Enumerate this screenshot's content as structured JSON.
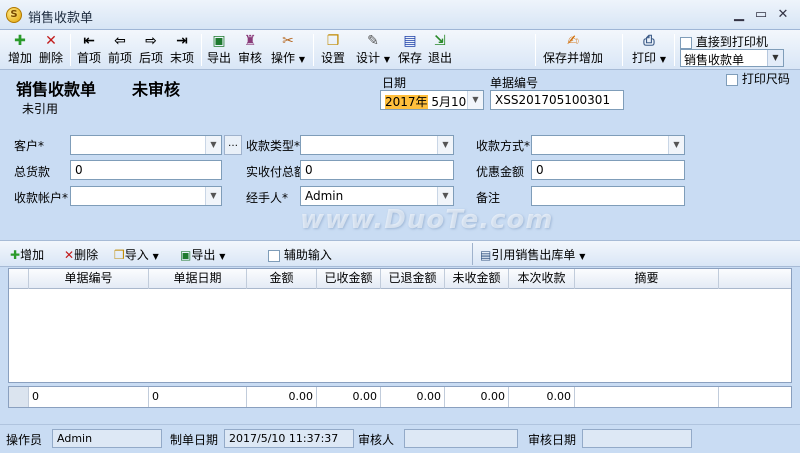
{
  "window": {
    "title": "销售收款单"
  },
  "toolbar": {
    "add": "增加",
    "delete": "删除",
    "first": "首项",
    "prev": "前项",
    "next": "后项",
    "last": "末项",
    "export": "导出",
    "audit": "审核",
    "operate": "操作",
    "settings": "设置",
    "design": "设计",
    "save": "保存",
    "exit": "退出",
    "save_and_add": "保存并增加",
    "print": "打印",
    "print_direct": "直接到打印机",
    "print_template": "销售收款单",
    "print_size": "打印尺码"
  },
  "header": {
    "doc_title": "销售收款单",
    "audit_status": "未审核",
    "ref_status": "未引用",
    "date_label": "日期",
    "date_year": "2017年",
    "date_rest": " 5月10日",
    "doc_no_label": "单据编号",
    "doc_no": "XSS201705100301"
  },
  "form": {
    "customer_label": "客户*",
    "customer": "",
    "collect_type_label": "收款类型*",
    "collect_type": "",
    "collect_method_label": "收款方式*",
    "collect_method": "",
    "total_label": "总货款",
    "total": "0",
    "actual_label": "实收付总额",
    "actual": "0",
    "discount_label": "优惠金额",
    "discount": "0",
    "account_label": "收款帐户*",
    "account": "",
    "handler_label": "经手人*",
    "handler": "Admin",
    "remark_label": "备注",
    "remark": ""
  },
  "gridbar": {
    "add": "增加",
    "delete": "删除",
    "import": "导入",
    "export": "导出",
    "assist_input": "辅助输入",
    "ref_outbound": "引用销售出库单"
  },
  "grid": {
    "columns": [
      "单据编号",
      "单据日期",
      "金额",
      "已收金额",
      "已退金额",
      "未收金额",
      "本次收款",
      "摘要"
    ],
    "totals": [
      "0",
      "0",
      "0.00",
      "0.00",
      "0.00",
      "0.00",
      "0.00",
      ""
    ]
  },
  "status": {
    "operator_label": "操作员",
    "operator": "Admin",
    "created_label": "制单日期",
    "created": "2017/5/10 11:37:37",
    "auditor_label": "审核人",
    "auditor": "",
    "audit_date_label": "审核日期",
    "audit_date": ""
  },
  "watermark": "www.DuoTe.com",
  "colors": {
    "window_bg": "#c9dcf3",
    "accent": "#1c5fb8"
  }
}
